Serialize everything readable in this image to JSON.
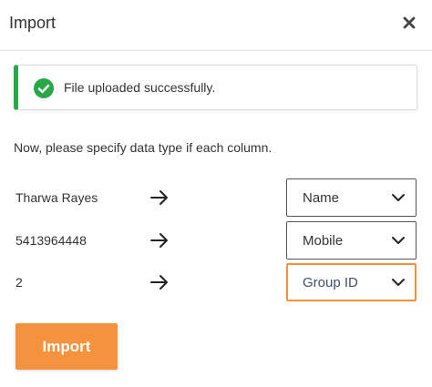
{
  "dialog": {
    "title": "Import",
    "close_icon": "close-icon"
  },
  "alert": {
    "icon": "check-circle-icon",
    "message": "File uploaded successfully.",
    "accent_color": "#28a745"
  },
  "instruction": "Now, please specify data type if each column.",
  "mapping": [
    {
      "value": "Tharwa Rayes",
      "type": "Name",
      "focused": false
    },
    {
      "value": "5413964448",
      "type": "Mobile",
      "focused": false
    },
    {
      "value": "2",
      "type": "Group ID",
      "focused": true
    }
  ],
  "import_button": {
    "label": "Import",
    "color": "#f5923e"
  }
}
